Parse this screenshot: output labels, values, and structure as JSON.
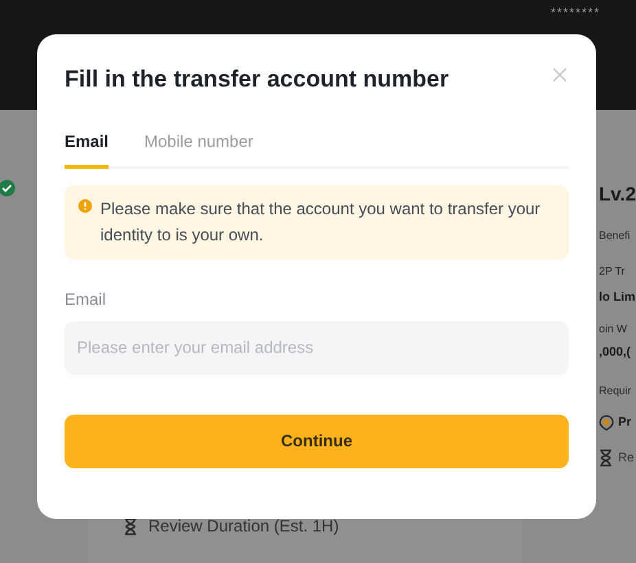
{
  "background": {
    "masked_value": "********",
    "left_verified": true,
    "review_duration": "Review Duration (Est. 1H)",
    "right_column": [
      {
        "kind": "heading",
        "text": "Lv.2"
      },
      {
        "kind": "label",
        "text": "Benefi"
      },
      {
        "kind": "label",
        "text": "2P Tr"
      },
      {
        "kind": "value",
        "text": "lo Lim"
      },
      {
        "kind": "label",
        "text": "oin W"
      },
      {
        "kind": "value",
        "text": ",000,("
      },
      {
        "kind": "label",
        "text": "Requir"
      },
      {
        "kind": "badge-item",
        "text": "Pr"
      },
      {
        "kind": "timer-item",
        "text": "Re"
      }
    ]
  },
  "dialog": {
    "title": "Fill in the transfer account number",
    "tabs": [
      {
        "label": "Email",
        "selected": true
      },
      {
        "label": "Mobile number",
        "selected": false
      }
    ],
    "notice": "Please make sure that the account you want to transfer your identity to is your own.",
    "field": {
      "label": "Email",
      "placeholder": "Please enter your email address"
    },
    "button": "Continue"
  }
}
